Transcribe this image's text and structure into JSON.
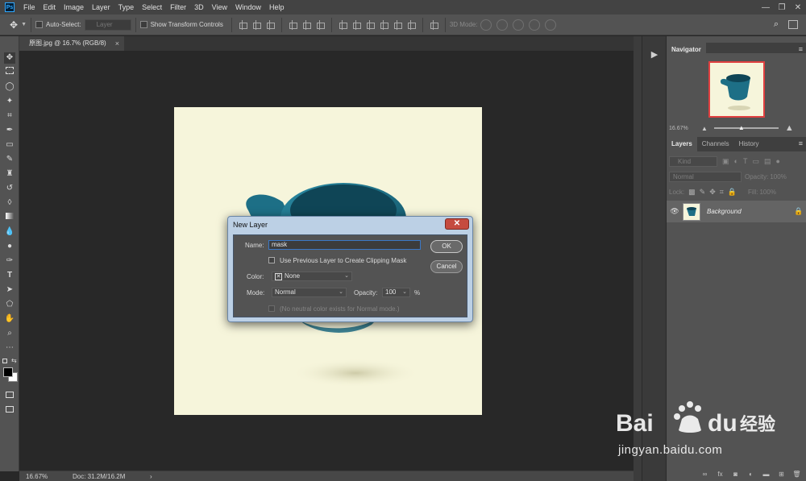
{
  "app": {
    "logo_text": "Ps",
    "menus": [
      "File",
      "Edit",
      "Image",
      "Layer",
      "Type",
      "Select",
      "Filter",
      "3D",
      "View",
      "Window",
      "Help"
    ],
    "window_controls": [
      "—",
      "❐",
      "✕"
    ]
  },
  "options_bar": {
    "auto_select_label": "Auto-Select:",
    "auto_select_value": "Layer",
    "transform_controls_label": "Show Transform Controls",
    "mode_3d_label": "3D Mode:"
  },
  "document_tab": {
    "title": "原图.jpg @ 16.7% (RGB/8)",
    "close": "×"
  },
  "status_bar": {
    "zoom": "16.67%",
    "doc_size": "Doc: 31.2M/16.2M",
    "arrow": "›"
  },
  "navigator": {
    "tab_label": "Navigator",
    "zoom": "16.67%"
  },
  "layers_panel": {
    "tabs": [
      "Layers",
      "Channels",
      "History"
    ],
    "kind_placeholder": "Kind",
    "blend_mode": "Normal",
    "opacity_label": "Opacity:",
    "opacity_value": "100%",
    "lock_label": "Lock:",
    "fill_label": "Fill:",
    "fill_value": "100%",
    "layers": [
      {
        "name": "Background",
        "visible": true,
        "locked": true
      }
    ]
  },
  "dialog": {
    "title": "New Layer",
    "close": "✕",
    "name_label": "Name:",
    "name_value": "mask",
    "clipping_mask_label": "Use Previous Layer to Create Clipping Mask",
    "color_label": "Color:",
    "color_value": "None",
    "mode_label": "Mode:",
    "mode_value": "Normal",
    "opacity_label": "Opacity:",
    "opacity_value": "100",
    "opacity_unit": "%",
    "neutral_color_label": "(No neutral color exists for Normal mode.)",
    "ok_label": "OK",
    "cancel_label": "Cancel"
  },
  "watermark": {
    "logo_text": "Bai du 经验",
    "url": "jingyan.baidu.com"
  },
  "colors": {
    "canvas_bg": "#f6f5db",
    "cup_teal": "#1d6f86",
    "dialog_frame": "#bcd0e5",
    "close_red": "#c54b3f",
    "focus_blue": "#3b78c6"
  }
}
